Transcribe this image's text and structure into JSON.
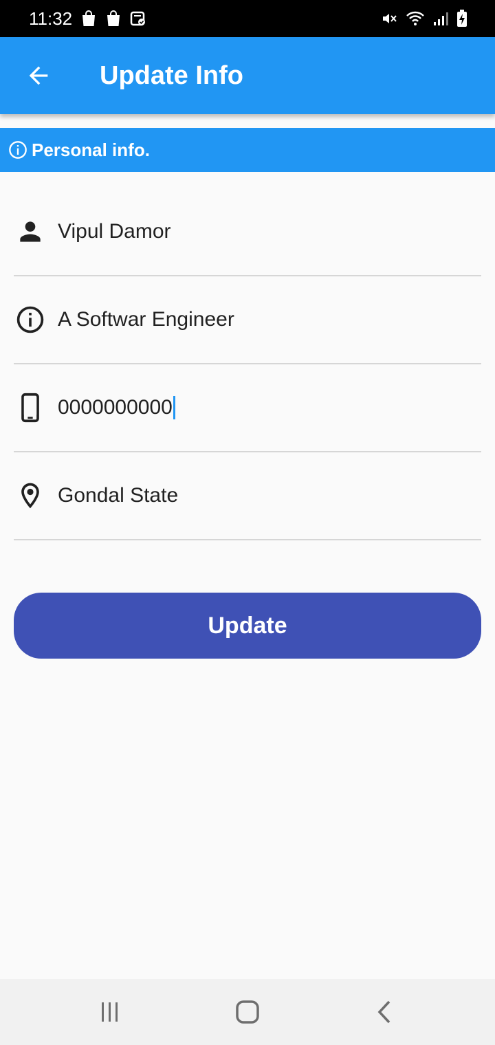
{
  "status_bar": {
    "time": "11:32",
    "left_icons": [
      "shopping-bag-icon",
      "shopping-bag-icon",
      "app-check-icon"
    ],
    "right_icons": [
      "mute-icon",
      "wifi-icon",
      "signal-icon",
      "battery-charging-icon"
    ]
  },
  "app_bar": {
    "title": "Update Info",
    "back_icon": "arrow-back-icon",
    "background": "#2196f3"
  },
  "section": {
    "title": "Personal info.",
    "icon": "info-outline-icon"
  },
  "fields": [
    {
      "icon": "person-icon",
      "value": "Vipul Damor"
    },
    {
      "icon": "info-outline-icon",
      "value": "A Softwar Engineer"
    },
    {
      "icon": "phone-icon",
      "value": "0000000000",
      "focused": true
    },
    {
      "icon": "location-pin-icon",
      "value": "Gondal State"
    }
  ],
  "update_button": {
    "label": "Update",
    "color": "#3f51b5"
  },
  "nav_bar": {
    "icons": [
      "recent-apps-icon",
      "home-icon",
      "back-icon"
    ]
  }
}
